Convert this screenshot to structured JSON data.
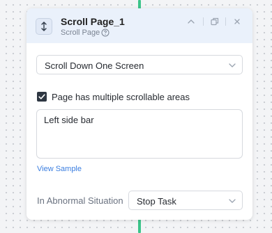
{
  "node": {
    "title": "Scroll Page_1",
    "subtitle": "Scroll Page",
    "header_icons": [
      "scroll-icon",
      "help-icon",
      "collapse-icon",
      "copy-icon",
      "close-icon"
    ]
  },
  "scroll_mode": {
    "selected": "Scroll Down One Screen"
  },
  "multi_scroll": {
    "checked": true,
    "label": "Page has multiple scrollable areas"
  },
  "scroll_area": {
    "value": "Left side bar"
  },
  "view_sample": {
    "label": "View Sample"
  },
  "abnormal": {
    "label": "In Abnormal Situation",
    "selected": "Stop Task"
  },
  "colors": {
    "connector": "#3cc48a",
    "header_bg": "#eaf1fb",
    "link": "#3b7ee0",
    "checkbox": "#2e3742"
  }
}
